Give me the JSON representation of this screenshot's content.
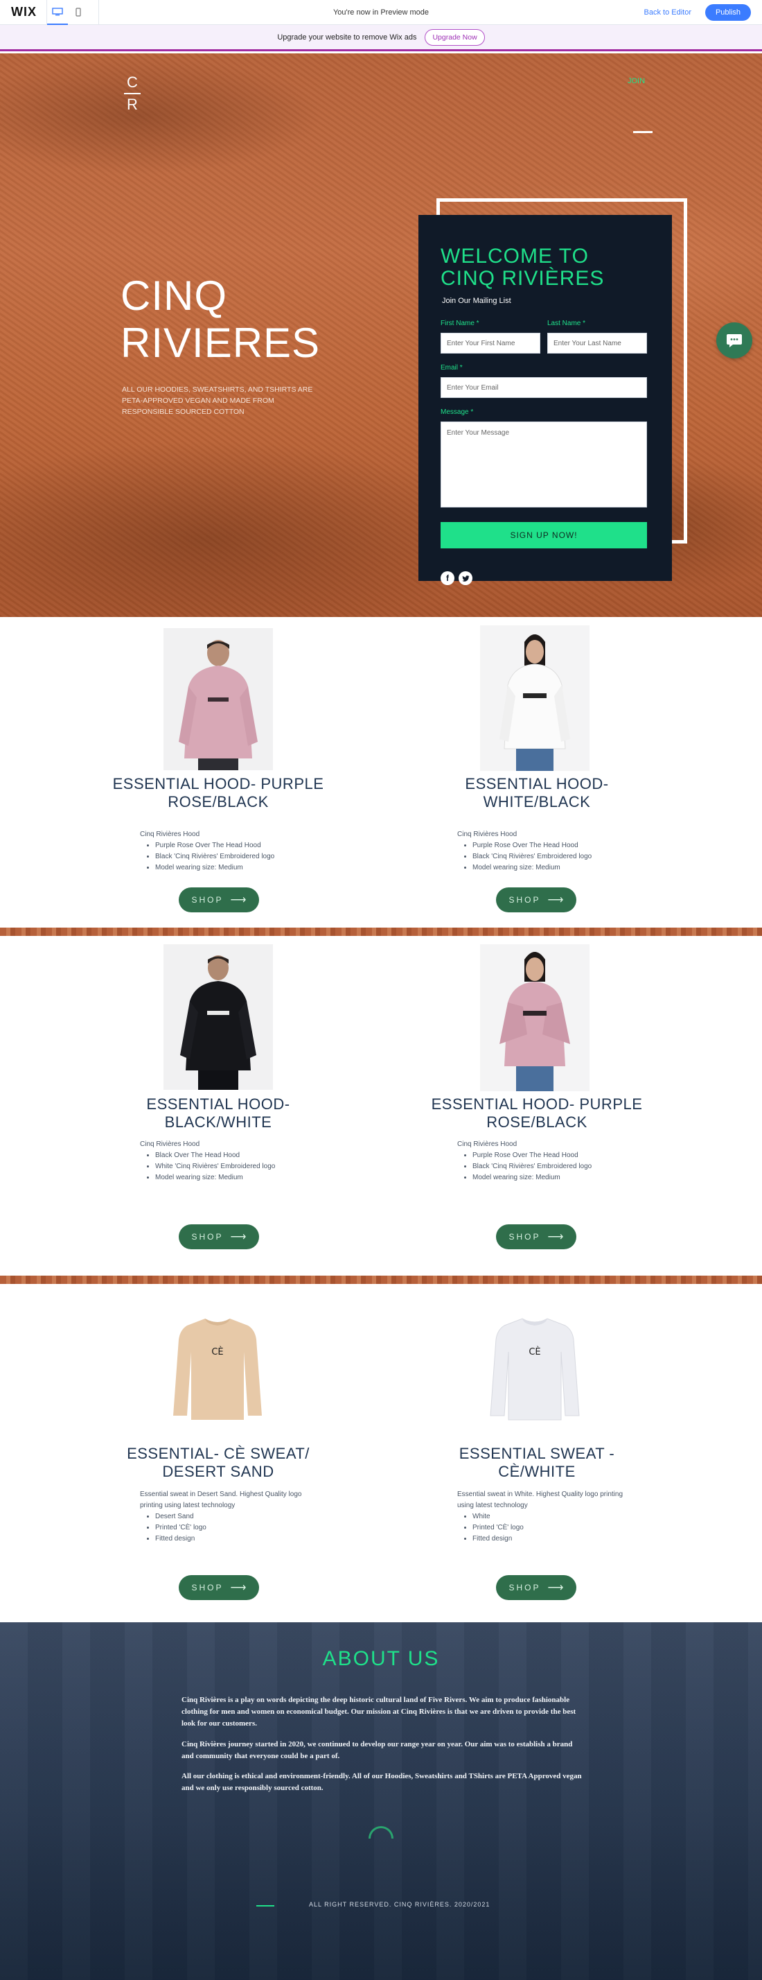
{
  "topbar": {
    "logo": "WIX",
    "preview_notice": "You're now in Preview mode",
    "back_to_editor": "Back to Editor",
    "publish": "Publish"
  },
  "upgrade": {
    "text": "Upgrade your website to remove Wix ads",
    "button": "Upgrade Now"
  },
  "hero": {
    "logo_top": "C",
    "logo_bottom": "R",
    "join_link": "JOIN",
    "title_line1": "CINQ",
    "title_line2": "RIVIERES",
    "subtitle": "ALL OUR HOODIES, SWEATSHIRTS, AND TSHIRTS ARE PETA-APPROVED VEGAN AND MADE FROM RESPONSIBLE SOURCED COTTON"
  },
  "form": {
    "title_line1": "WELCOME TO",
    "title_line2": "CINQ RIVIÈRES",
    "subtitle": "Join Our Mailing List",
    "first_name_label": "First Name *",
    "first_name_placeholder": "Enter Your First Name",
    "last_name_label": "Last Name *",
    "last_name_placeholder": "Enter Your Last Name",
    "email_label": "Email *",
    "email_placeholder": "Enter Your Email",
    "message_label": "Message *",
    "message_placeholder": "Enter Your Message",
    "submit": "SIGN UP NOW!"
  },
  "products": [
    {
      "title_line1": "ESSENTIAL HOOD- PURPLE",
      "title_line2": "ROSE/BLACK",
      "intro": "Cinq Rivières Hood",
      "bullets": [
        "Purple Rose Over The Head Hood",
        "Black 'Cinq Rivières' Embroidered logo",
        "Model wearing size: Medium"
      ],
      "shop": "SHOP"
    },
    {
      "title_line1": "ESSENTIAL HOOD-",
      "title_line2": "WHITE/BLACK",
      "intro": "Cinq Rivières Hood",
      "bullets": [
        "Purple Rose Over The Head Hood",
        "Black 'Cinq Rivières' Embroidered logo",
        "Model wearing size: Medium"
      ],
      "shop": "SHOP"
    },
    {
      "title_line1": "ESSENTIAL HOOD-",
      "title_line2": "BLACK/WHITE",
      "intro": "Cinq Rivières Hood",
      "bullets": [
        "Black Over The Head Hood",
        "White 'Cinq Rivières' Embroidered logo",
        "Model wearing size: Medium"
      ],
      "shop": "SHOP"
    },
    {
      "title_line1": "ESSENTIAL HOOD- PURPLE",
      "title_line2": "ROSE/BLACK",
      "intro": "Cinq Rivières Hood",
      "bullets": [
        "Purple Rose Over The Head Hood",
        "Black 'Cinq Rivières' Embroidered logo",
        "Model wearing size: Medium"
      ],
      "shop": "SHOP"
    },
    {
      "title_line1": "ESSENTIAL- CÈ SWEAT/",
      "title_line2": "DESERT SAND",
      "intro": "Essential sweat in Desert Sand. Highest Quality logo printing using latest technology",
      "bullets": [
        "Desert Sand",
        "Printed 'CÈ' logo",
        "Fitted design"
      ],
      "shop": "SHOP"
    },
    {
      "title_line1": "ESSENTIAL SWEAT -",
      "title_line2": "CÈ/WHITE",
      "intro": "Essential sweat in White. Highest Quality logo printing using latest technology",
      "bullets": [
        "White",
        "Printed 'CÈ' logo",
        "Fitted design"
      ],
      "shop": "SHOP"
    }
  ],
  "about": {
    "title": "ABOUT US",
    "p1": "Cinq Rivières is a play on words depicting the deep historic cultural land of Five Rivers. We aim to produce fashionable clothing for men and women on economical budget. Our mission at Cinq Rivières is that we are driven to provide the best look for our customers.",
    "p2": "Cinq Rivières journey started in 2020, we continued to develop our range year on year. Our aim was to establish a brand and community that everyone could be a part of.",
    "p3": "All our clothing is ethical and environment-friendly. All of our Hoodies, Sweatshirts and TShirts are PETA Approved vegan and we only use responsibly sourced cotton.",
    "footer": "ALL RIGHT RESERVED. CINQ RIVIÈRES. 2020/2021"
  },
  "colors": {
    "accent_green": "#1fe08a",
    "shop_button": "#2f6e4b",
    "form_bg": "#101a28",
    "title_navy": "#1f3450",
    "hero_terracotta": "#c46d42"
  }
}
